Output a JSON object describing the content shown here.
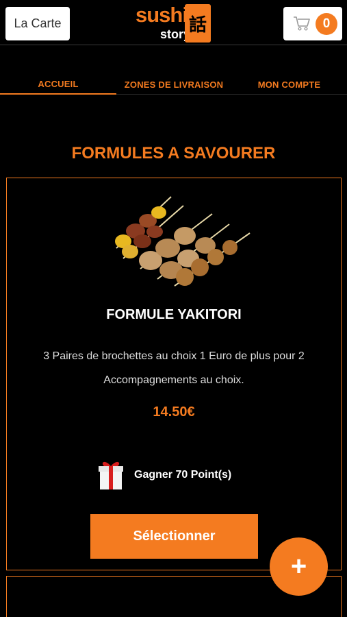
{
  "header": {
    "menu_button_label": "La Carte",
    "logo_text_main": "sushi",
    "logo_text_sub": "story",
    "logo_kanji": "話",
    "cart_count": "0"
  },
  "nav": {
    "items": [
      {
        "label": "ACCUEIL",
        "active": true
      },
      {
        "label": "ZONES DE LIVRAISON",
        "active": false
      },
      {
        "label": "MON COMPTE",
        "active": false
      }
    ]
  },
  "section": {
    "title": "FORMULES A SAVOURER"
  },
  "product": {
    "image_icon": "yakitori-skewers-image",
    "name": "FORMULE YAKITORI",
    "description": "3 Paires de brochettes au choix  1 Euro de plus pour 2 Accompagnements au choix.",
    "price": "14.50€",
    "points_label": "Gagner 70 Point(s)",
    "select_button_label": "Sélectionner"
  },
  "fab": {
    "label": "+"
  },
  "colors": {
    "accent": "#f47b20",
    "background": "#000000",
    "button_light": "#ffffff"
  }
}
